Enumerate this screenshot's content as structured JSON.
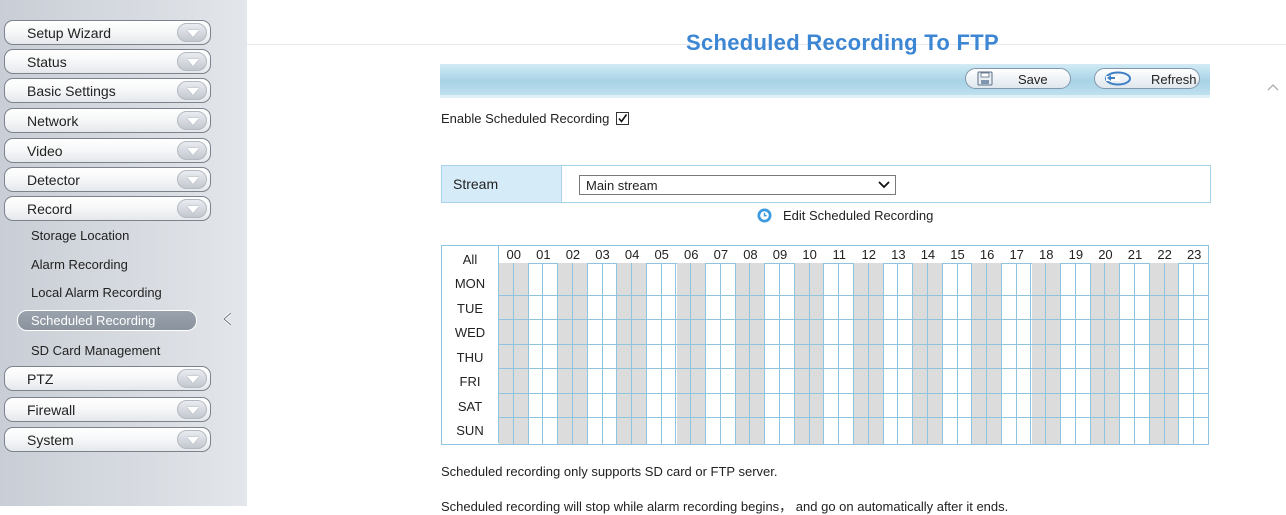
{
  "sidebar": {
    "menu": [
      {
        "label": "Setup Wizard"
      },
      {
        "label": "Status"
      },
      {
        "label": "Basic Settings"
      },
      {
        "label": "Network"
      },
      {
        "label": "Video"
      },
      {
        "label": "Detector"
      },
      {
        "label": "Record"
      }
    ],
    "record_sub": [
      {
        "label": "Storage Location"
      },
      {
        "label": "Alarm Recording"
      },
      {
        "label": "Local Alarm Recording"
      },
      {
        "label": "Scheduled Recording"
      },
      {
        "label": "SD Card Management"
      }
    ],
    "menu_bottom": [
      {
        "label": "PTZ"
      },
      {
        "label": "Firewall"
      },
      {
        "label": "System"
      }
    ]
  },
  "page": {
    "title": "Scheduled Recording To FTP"
  },
  "toolbar": {
    "save_label": "Save",
    "refresh_label": "Refresh"
  },
  "enable": {
    "label": "Enable Scheduled Recording",
    "checked": true
  },
  "stream": {
    "label": "Stream",
    "value": "Main stream"
  },
  "edit_schedule_label": "Edit Scheduled Recording",
  "schedule": {
    "all_label": "All",
    "days": [
      "MON",
      "TUE",
      "WED",
      "THU",
      "FRI",
      "SAT",
      "SUN"
    ],
    "hours": [
      "00",
      "01",
      "02",
      "03",
      "04",
      "05",
      "06",
      "07",
      "08",
      "09",
      "10",
      "11",
      "12",
      "13",
      "14",
      "15",
      "16",
      "17",
      "18",
      "19",
      "20",
      "21",
      "22",
      "23"
    ]
  },
  "notes": {
    "line1": "Scheduled recording only supports SD card or FTP server.",
    "line2": "Scheduled recording will stop while alarm recording begins， and go on automatically after it ends."
  },
  "colors": {
    "title": "#3c86d4",
    "grid_line": "#8fc3e0",
    "shaded_hour": "#dcdcdc",
    "toolbar": "#a7d3e6",
    "stream_label_bg": "#d5ebf8"
  }
}
